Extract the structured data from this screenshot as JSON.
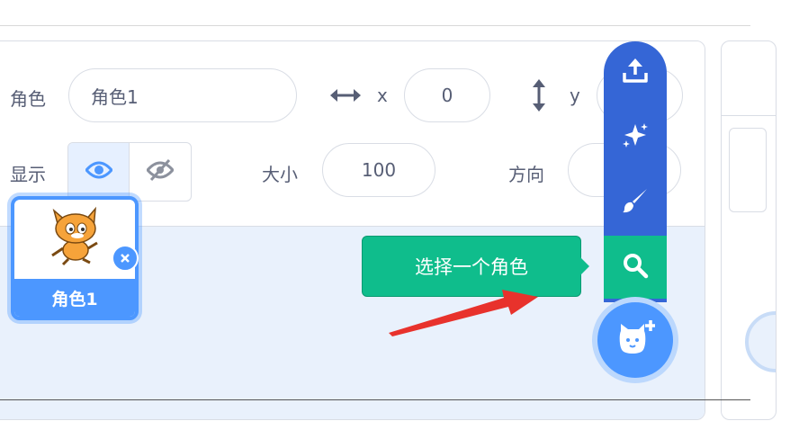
{
  "sprite_info": {
    "sprite_label": "角色",
    "sprite_name_value": "角色1",
    "x_label": "x",
    "x_value": "0",
    "y_label": "y",
    "show_label": "显示",
    "size_label": "大小",
    "size_value": "100",
    "direction_label": "方向"
  },
  "sprites": [
    {
      "name": "角色1"
    }
  ],
  "sprite_menu": {
    "tooltip": "选择一个角色",
    "items": [
      {
        "icon": "upload-icon"
      },
      {
        "icon": "surprise-icon"
      },
      {
        "icon": "paint-icon"
      },
      {
        "icon": "search-icon"
      }
    ],
    "add_icon": "cat-plus-icon"
  },
  "colors": {
    "primary": "#4c97ff",
    "menu_blue": "#3566d6",
    "tooltip_green": "#0fbd8c",
    "list_bg": "#e9f1fc",
    "arrow_red": "#e8322c"
  }
}
